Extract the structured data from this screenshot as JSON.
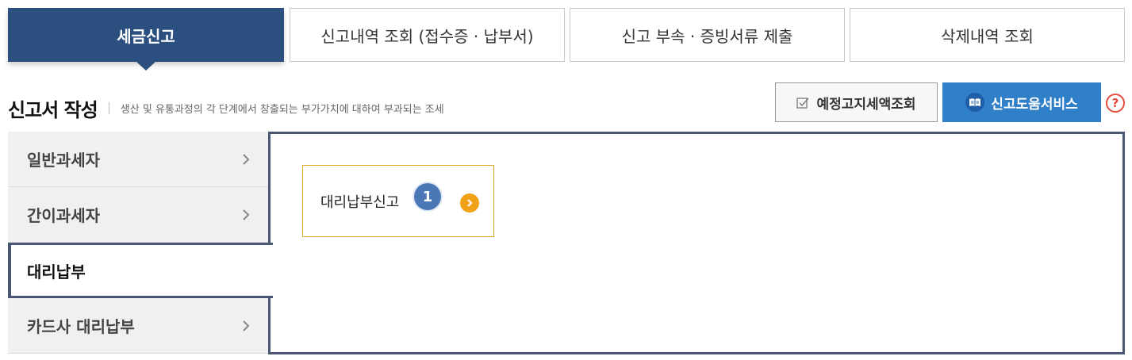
{
  "tabs": [
    {
      "label": "세금신고",
      "active": true
    },
    {
      "label": "신고내역 조회 (접수증 · 납부서)",
      "active": false
    },
    {
      "label": "신고 부속 · 증빙서류 제출",
      "active": false
    },
    {
      "label": "삭제내역 조회",
      "active": false
    }
  ],
  "header": {
    "title": "신고서 작성",
    "description": "생산 및 유통과정의 각 단계에서 창출되는 부가가치에 대하여 부과되는 조세"
  },
  "buttons": {
    "inquiry_label": "예정고지세액조회",
    "inquiry_icon": "checkbox-icon",
    "help_service_label": "신고도움서비스",
    "help_service_icon": "book-icon",
    "help_mark": "?"
  },
  "sidebar": {
    "items": [
      {
        "label": "일반과세자",
        "active": false
      },
      {
        "label": "간이과세자",
        "active": false
      },
      {
        "label": "대리납부",
        "active": true
      },
      {
        "label": "카드사 대리납부",
        "active": false
      }
    ]
  },
  "content": {
    "card_label": "대리납부신고",
    "badge": "1"
  },
  "colors": {
    "primary": "#2b4f7e",
    "blue_button": "#2f7fc9",
    "card_border": "#e0a426",
    "arrow_circle": "#f2a218",
    "badge": "#4a78b6",
    "help_red": "#e34b3c"
  }
}
